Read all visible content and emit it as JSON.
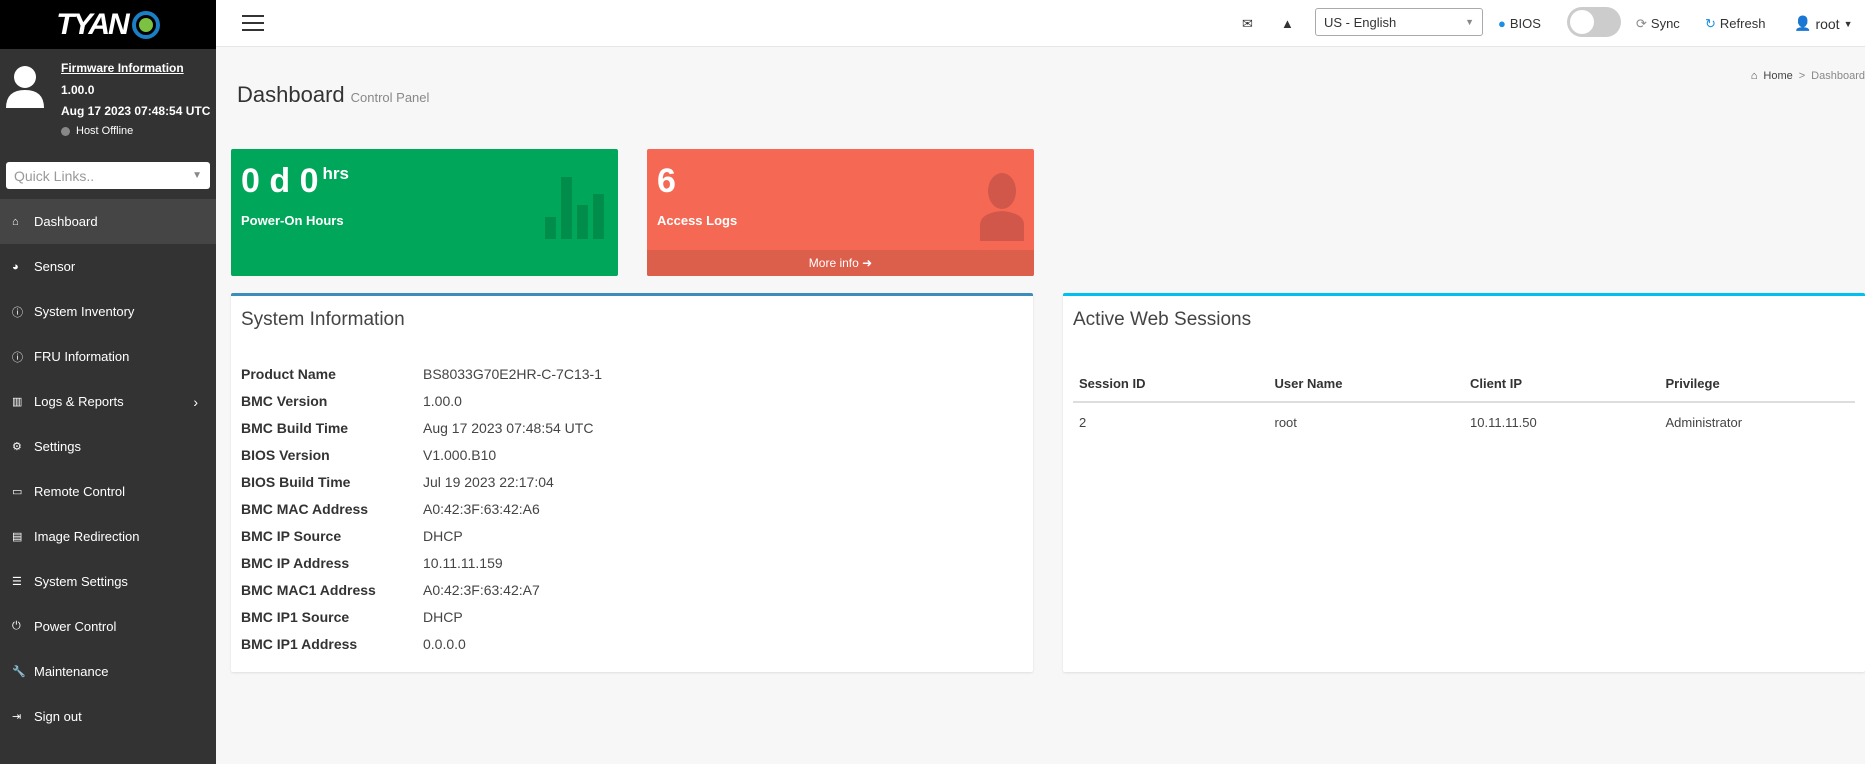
{
  "logo": {
    "text": "TYAN"
  },
  "user": {
    "firmware_link": "Firmware Information",
    "version": "1.00.0",
    "datetime": "Aug 17 2023 07:48:54 UTC",
    "host_status": "Host Offline"
  },
  "quick_links": {
    "placeholder": "Quick Links.."
  },
  "nav": [
    {
      "label": "Dashboard",
      "icon": "home-icon",
      "glyph": "⌂"
    },
    {
      "label": "Sensor",
      "icon": "gauge-icon",
      "glyph": "◕"
    },
    {
      "label": "System Inventory",
      "icon": "info-icon",
      "glyph": "ⓘ"
    },
    {
      "label": "FRU Information",
      "icon": "info-icon",
      "glyph": "ⓘ"
    },
    {
      "label": "Logs & Reports",
      "icon": "bar-chart-icon",
      "glyph": "▥"
    },
    {
      "label": "Settings",
      "icon": "gear-icon",
      "glyph": "⚙"
    },
    {
      "label": "Remote Control",
      "icon": "monitor-icon",
      "glyph": "▭"
    },
    {
      "label": "Image Redirection",
      "icon": "drive-icon",
      "glyph": "▤"
    },
    {
      "label": "System Settings",
      "icon": "server-icon",
      "glyph": "☰"
    },
    {
      "label": "Power Control",
      "icon": "power-icon",
      "glyph": "⏻"
    },
    {
      "label": "Maintenance",
      "icon": "wrench-icon",
      "glyph": "🔧"
    },
    {
      "label": "Sign out",
      "icon": "sign-out-icon",
      "glyph": "⇥"
    }
  ],
  "header": {
    "language": "US - English",
    "bios": "BIOS",
    "sync": "Sync",
    "refresh": "Refresh",
    "user": "root"
  },
  "page": {
    "title": "Dashboard",
    "subtitle": "Control Panel",
    "breadcrumb_home": "Home",
    "breadcrumb_sep": ">",
    "breadcrumb_current": "Dashboard"
  },
  "cards": {
    "power": {
      "value": "0 d 0",
      "unit": "hrs",
      "label": "Power-On Hours",
      "color": "#00a65a"
    },
    "logs": {
      "value": "6",
      "label": "Access Logs",
      "more": "More info",
      "color": "#f56954"
    }
  },
  "system_info": {
    "title": "System Information",
    "rows": [
      {
        "k": "Product Name",
        "v": "BS8033G70E2HR-C-7C13-1"
      },
      {
        "k": "BMC Version",
        "v": "1.00.0"
      },
      {
        "k": "BMC Build Time",
        "v": "Aug 17 2023 07:48:54 UTC"
      },
      {
        "k": "BIOS Version",
        "v": "V1.000.B10"
      },
      {
        "k": "BIOS Build Time",
        "v": "Jul 19 2023 22:17:04"
      },
      {
        "k": "BMC MAC Address",
        "v": "A0:42:3F:63:42:A6"
      },
      {
        "k": "BMC IP Source",
        "v": "DHCP"
      },
      {
        "k": "BMC IP Address",
        "v": "10.11.11.159"
      },
      {
        "k": "BMC MAC1 Address",
        "v": "A0:42:3F:63:42:A7"
      },
      {
        "k": "BMC IP1 Source",
        "v": "DHCP"
      },
      {
        "k": "BMC IP1 Address",
        "v": "0.0.0.0"
      }
    ]
  },
  "sessions": {
    "title": "Active Web Sessions",
    "columns": [
      "Session ID",
      "User Name",
      "Client IP",
      "Privilege"
    ],
    "rows": [
      [
        "2",
        "root",
        "10.11.11.50",
        "Administrator"
      ]
    ]
  }
}
